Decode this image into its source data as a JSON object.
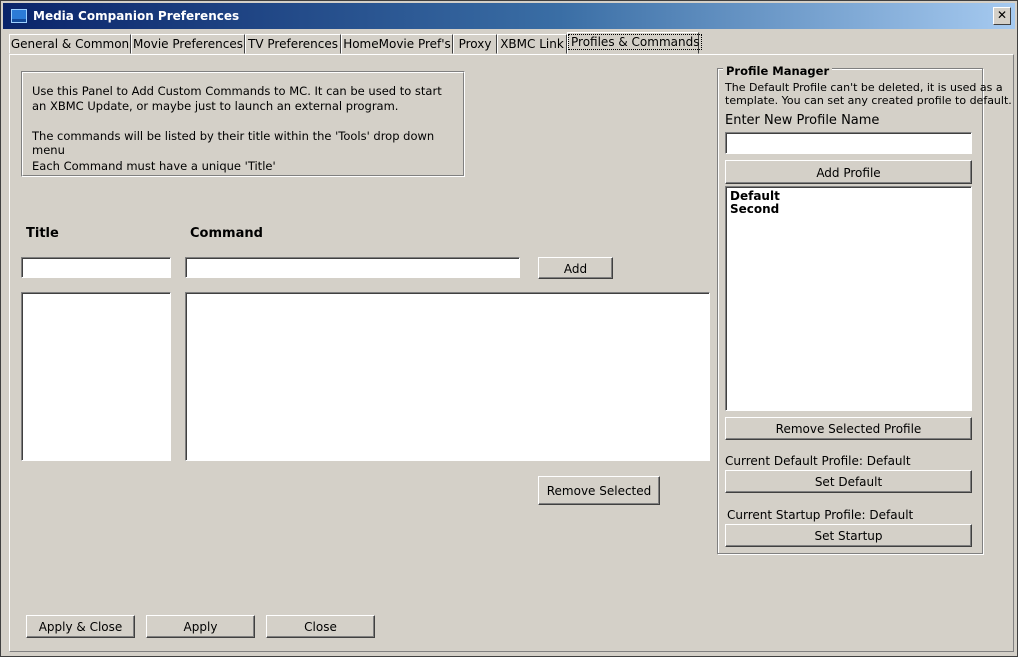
{
  "window": {
    "title": "Media Companion Preferences",
    "close": "✕"
  },
  "tabs": [
    {
      "label": "General & Common"
    },
    {
      "label": "Movie Preferences"
    },
    {
      "label": "TV Preferences"
    },
    {
      "label": "HomeMovie Pref's"
    },
    {
      "label": "Proxy"
    },
    {
      "label": "XBMC Link"
    },
    {
      "label": "Profiles & Commands"
    }
  ],
  "info": {
    "line1": "Use this Panel to Add Custom Commands to MC.  It can be used to start",
    "line2": "an XBMC Update, or maybe just to launch an external program.",
    "line3": "The commands will be listed by their title within the 'Tools' drop down menu",
    "line4": "Each Command must have a unique 'Title'"
  },
  "commands": {
    "title_label": "Title",
    "command_label": "Command",
    "title_value": "",
    "command_value": "",
    "add_button": "Add",
    "remove_button": "Remove Selected"
  },
  "profile_manager": {
    "title": "Profile Manager",
    "desc1": "The Default Profile can't be deleted, it is used as a",
    "desc2": "template. You can set any created profile to default.",
    "new_label": "Enter New Profile Name",
    "new_value": "",
    "add_button": "Add Profile",
    "profiles": [
      "Default",
      "Second"
    ],
    "remove_button": "Remove Selected Profile",
    "current_default": "Current Default Profile: Default",
    "set_default_button": "Set Default",
    "current_startup": "Current Startup Profile: Default",
    "set_startup_button": "Set Startup"
  },
  "footer": {
    "apply_close": "Apply  &  Close",
    "apply": "Apply",
    "close": "Close"
  }
}
